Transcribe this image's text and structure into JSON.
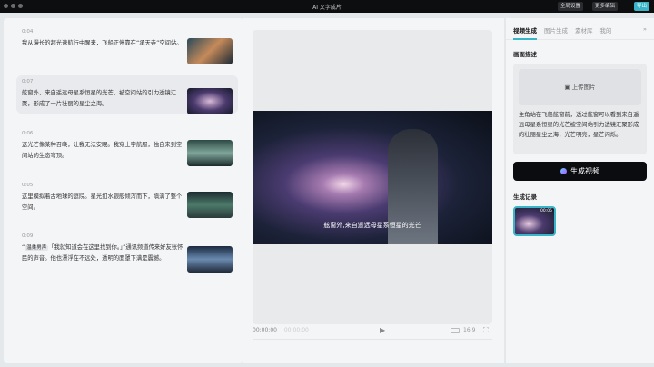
{
  "window": {
    "title": "AI 文字成片",
    "buttons": [
      "全局设置",
      "更多编辑",
      "导出"
    ]
  },
  "segments": [
    {
      "time": "0:04",
      "text": "我从漫长的超光速航行中醒来，飞船正停靠在“承天寺”空间站。",
      "active": false
    },
    {
      "time": "0:07",
      "text": "舷窗外，来自遥远母星系恒星的光芒，被空间站的引力透镜汇聚，形成了一片壮丽的星尘之海。",
      "active": true
    },
    {
      "time": "0:06",
      "text": "这光芒像某种召唤，让我无法安眠。我穿上宇航服，独自来到空间站的生态穹顶。",
      "active": false
    },
    {
      "time": "0:05",
      "text": "这里模拟着古地球的庭院。星光如水银般倾泻而下，填满了整个空间。",
      "active": false
    },
    {
      "time": "0:09",
      "voice": "温柔男声",
      "text_quote": "「我就知道会在这里找到你。」",
      "text": "”通讯频道传来好友张怀民的声音。他也漂浮在不远处，透明的面罩下满是震撼。",
      "active": false
    }
  ],
  "player": {
    "subtitle": "舷窗外,来自遥远母星系恒星的光芒",
    "current_time": "00:00:00",
    "total_time": "00:00:00",
    "ratio": "16:9"
  },
  "right": {
    "tabs": [
      "视频生成",
      "图片生成",
      "素材库",
      "我的"
    ],
    "active_tab": "视频生成",
    "desc_label": "画面描述",
    "upload_label": "上传图片",
    "description": "主角站在飞船舷窗前，透过舷窗可以看到来自遥远母星系恒星的光芒被空间站引力透镜汇聚形成的壮丽星尘之海，光芒明亮，星芒闪烁。",
    "generate_label": "生成视频",
    "records_label": "生成记录",
    "record_duration": "00:05"
  },
  "colors": {
    "accent": "#3ab5c8",
    "dark": "#0b0c10"
  }
}
